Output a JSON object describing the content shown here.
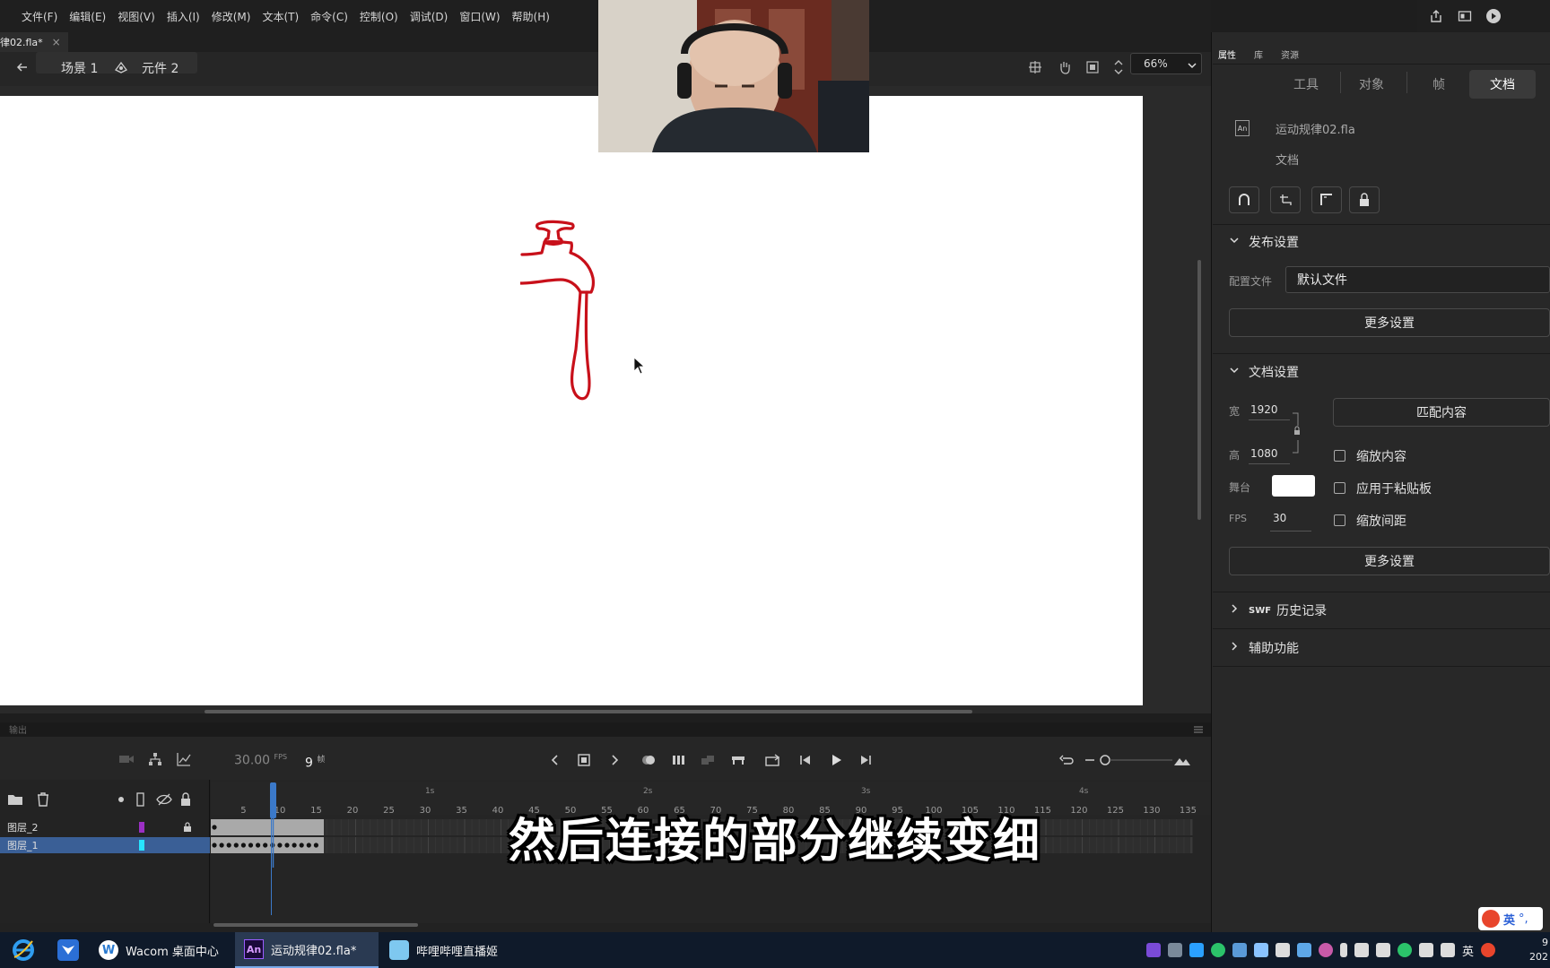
{
  "menu": [
    "文件(F)",
    "编辑(E)",
    "视图(V)",
    "插入(I)",
    "修改(M)",
    "文本(T)",
    "命令(C)",
    "控制(O)",
    "调试(D)",
    "窗口(W)",
    "帮助(H)"
  ],
  "document_tab": {
    "title": "律02.fla*",
    "close": "×"
  },
  "scene_bar": {
    "scene": "场景 1",
    "symbol": "元件 2",
    "zoom": "66%"
  },
  "timeline": {
    "output_label": "输出",
    "fps": "30.00",
    "fps_unit": "FPS",
    "frame": "9",
    "frame_unit": "帧",
    "seconds": [
      "1s",
      "2s",
      "3s",
      "4s"
    ],
    "ruler": [
      "5",
      "10",
      "15",
      "20",
      "25",
      "30",
      "35",
      "40",
      "45",
      "50",
      "55",
      "60",
      "65",
      "70",
      "75",
      "80",
      "85",
      "90",
      "95",
      "100",
      "105",
      "110",
      "115",
      "120",
      "125",
      "130",
      "135"
    ],
    "layers": [
      {
        "name": "图层_2",
        "color": "#9b2fc4"
      },
      {
        "name": "图层_1",
        "color": "#27e4ff"
      }
    ]
  },
  "properties": {
    "tabs": [
      "属性",
      "库",
      "资源"
    ],
    "segments": [
      "工具",
      "对象",
      "帧",
      "文档"
    ],
    "file_name": "运动规律02.fla",
    "file_type": "文档",
    "file_icon": "An",
    "publish": {
      "title": "发布设置",
      "profile_label": "配置文件",
      "profile_value": "默认文件",
      "more": "更多设置"
    },
    "document": {
      "title": "文档设置",
      "width_label": "宽",
      "width": "1920",
      "height_label": "高",
      "height": "1080",
      "match": "匹配内容",
      "scale_content": "缩放内容",
      "apply_pasteboard": "应用于粘贴板",
      "scale_spacing": "缩放间距",
      "stage_label": "舞台",
      "stage_color": "#ffffff",
      "fps_label": "FPS",
      "fps": "30",
      "more": "更多设置"
    },
    "swf_history": {
      "prefix": "SWF",
      "title": "历史记录"
    },
    "accessibility": "辅助功能"
  },
  "subtitle": "然后连接的部分继续变细",
  "taskbar": {
    "apps": [
      {
        "label": "Wacom 桌面中心"
      },
      {
        "label": "运动规律02.fla*"
      },
      {
        "label": "哔哩哔哩直播姬"
      }
    ],
    "ime": "英",
    "ime_badge": "英",
    "clock_top": "9",
    "clock_bottom": "202"
  },
  "colors": {
    "faucet": "#c8101a",
    "accent": "#3b79c9"
  }
}
